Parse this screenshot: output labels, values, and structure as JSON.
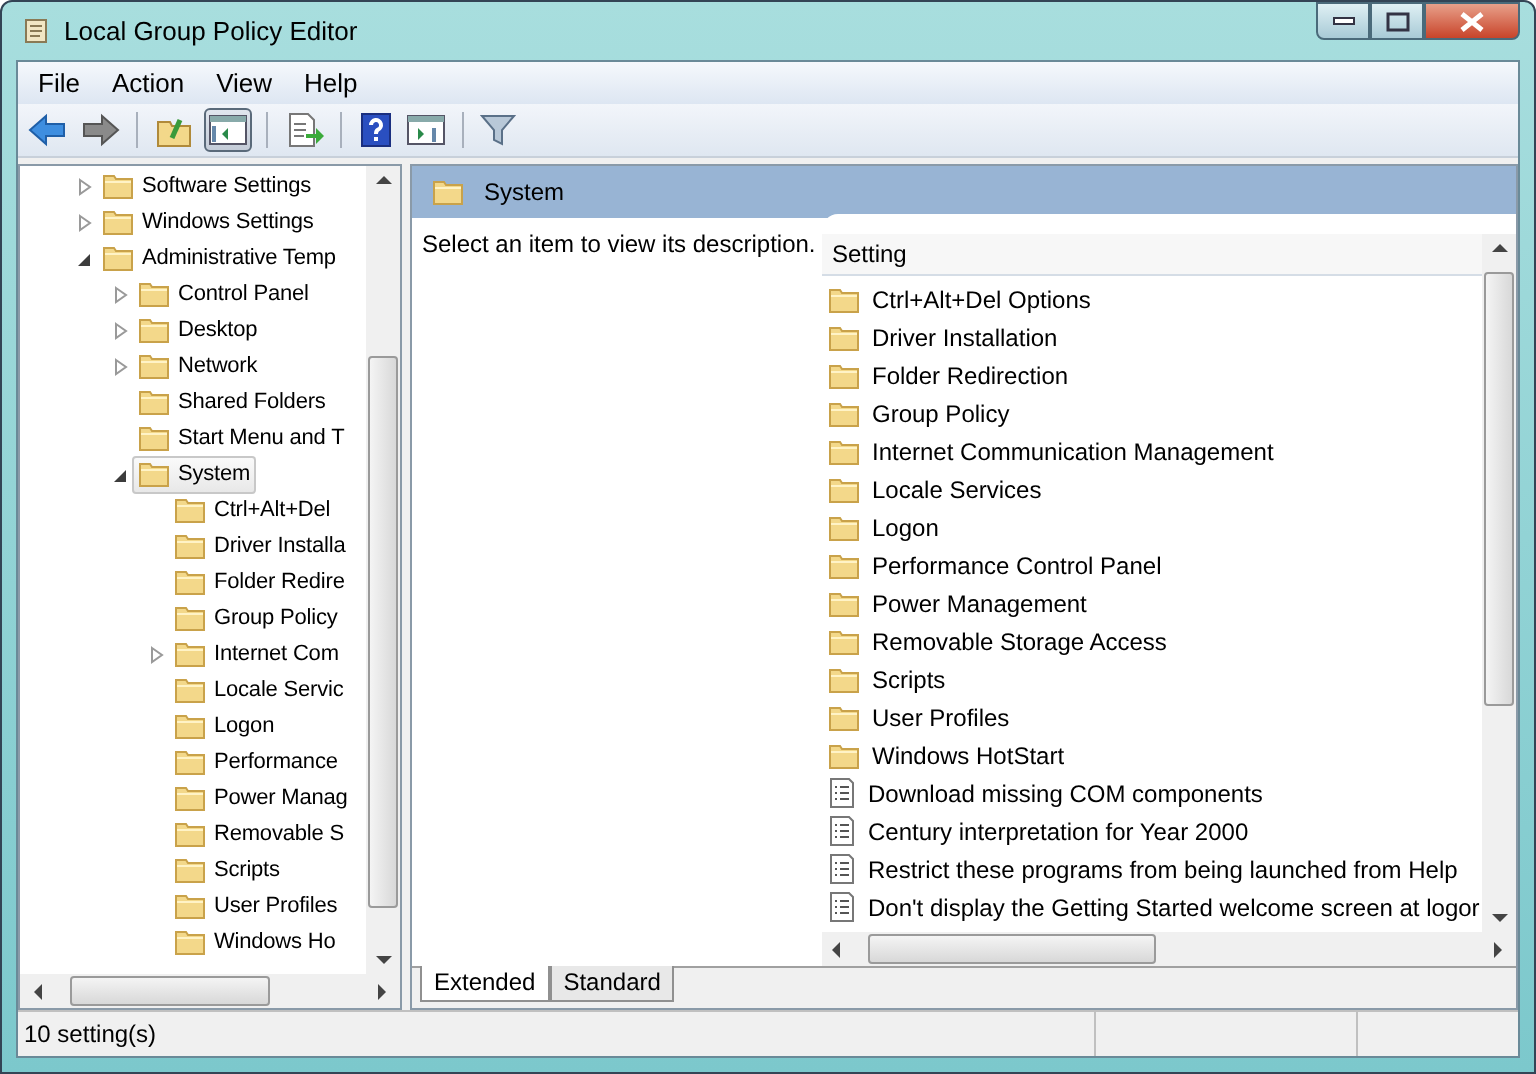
{
  "window": {
    "title": "Local Group Policy Editor"
  },
  "menu": [
    "File",
    "Action",
    "View",
    "Help"
  ],
  "toolbar": [
    {
      "kind": "back"
    },
    {
      "kind": "forward"
    },
    {
      "kind": "sep"
    },
    {
      "kind": "up"
    },
    {
      "kind": "pane",
      "selected": true
    },
    {
      "kind": "sep"
    },
    {
      "kind": "export"
    },
    {
      "kind": "sep"
    },
    {
      "kind": "help"
    },
    {
      "kind": "view"
    },
    {
      "kind": "sep"
    },
    {
      "kind": "filter"
    }
  ],
  "tree": [
    {
      "label": "Software Settings",
      "kind": "branch",
      "expanded": false,
      "selected": false
    },
    {
      "label": "Windows Settings",
      "kind": "branch",
      "expanded": false,
      "selected": false
    },
    {
      "label": "Administrative Temp",
      "kind": "branch",
      "expanded": true,
      "selected": false,
      "children": [
        {
          "label": "Control Panel",
          "kind": "branch",
          "expanded": false,
          "selected": false
        },
        {
          "label": "Desktop",
          "kind": "branch",
          "expanded": false,
          "selected": false
        },
        {
          "label": "Network",
          "kind": "branch",
          "expanded": false,
          "selected": false
        },
        {
          "label": "Shared Folders",
          "kind": "leaf",
          "selected": false
        },
        {
          "label": "Start Menu and T",
          "kind": "leaf",
          "selected": false
        },
        {
          "label": "System",
          "kind": "branch",
          "expanded": true,
          "selected": true,
          "children": [
            {
              "label": "Ctrl+Alt+Del",
              "kind": "leaf",
              "selected": false
            },
            {
              "label": "Driver Installa",
              "kind": "leaf",
              "selected": false
            },
            {
              "label": "Folder Redire",
              "kind": "leaf",
              "selected": false
            },
            {
              "label": "Group Policy",
              "kind": "leaf",
              "selected": false
            },
            {
              "label": "Internet Com",
              "kind": "branch",
              "expanded": false,
              "selected": false
            },
            {
              "label": "Locale Servic",
              "kind": "leaf",
              "selected": false
            },
            {
              "label": "Logon",
              "kind": "leaf",
              "selected": false
            },
            {
              "label": "Performance",
              "kind": "leaf",
              "selected": false
            },
            {
              "label": "Power Manag",
              "kind": "leaf",
              "selected": false
            },
            {
              "label": "Removable S",
              "kind": "leaf",
              "selected": false
            },
            {
              "label": "Scripts",
              "kind": "leaf",
              "selected": false
            },
            {
              "label": "User Profiles",
              "kind": "leaf",
              "selected": false
            },
            {
              "label": "Windows Ho",
              "kind": "leaf",
              "selected": false
            }
          ]
        }
      ]
    }
  ],
  "header": {
    "title": "System"
  },
  "description": "Select an item to view its description.",
  "list": {
    "column": "Setting",
    "items": [
      {
        "label": "Ctrl+Alt+Del Options",
        "kind": "folder"
      },
      {
        "label": "Driver Installation",
        "kind": "folder"
      },
      {
        "label": "Folder Redirection",
        "kind": "folder"
      },
      {
        "label": "Group Policy",
        "kind": "folder"
      },
      {
        "label": "Internet Communication Management",
        "kind": "folder"
      },
      {
        "label": "Locale Services",
        "kind": "folder"
      },
      {
        "label": "Logon",
        "kind": "folder"
      },
      {
        "label": "Performance Control Panel",
        "kind": "folder"
      },
      {
        "label": "Power Management",
        "kind": "folder"
      },
      {
        "label": "Removable Storage Access",
        "kind": "folder"
      },
      {
        "label": "Scripts",
        "kind": "folder"
      },
      {
        "label": "User Profiles",
        "kind": "folder"
      },
      {
        "label": "Windows HotStart",
        "kind": "folder"
      },
      {
        "label": "Download missing COM components",
        "kind": "setting"
      },
      {
        "label": "Century interpretation for Year 2000",
        "kind": "setting"
      },
      {
        "label": "Restrict these programs from being launched from Help",
        "kind": "setting"
      },
      {
        "label": "Don't display the Getting Started welcome screen at logor",
        "kind": "setting"
      }
    ]
  },
  "tabs": [
    {
      "label": "Extended",
      "selected": true
    },
    {
      "label": "Standard",
      "selected": false
    }
  ],
  "status_bar": "10 setting(s)"
}
